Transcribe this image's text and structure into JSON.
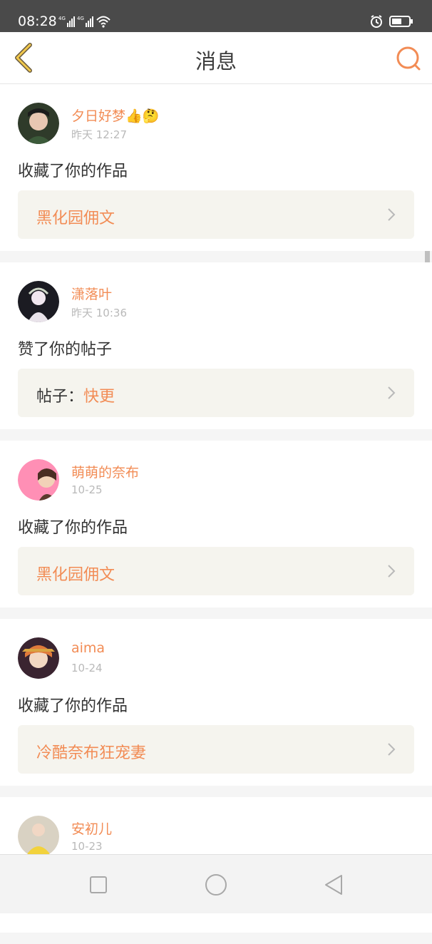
{
  "status_bar": {
    "time": "08:28",
    "network_1": "4G",
    "network_2": "4G"
  },
  "header": {
    "title": "消息"
  },
  "messages": [
    {
      "username": "夕日好梦👍🤔",
      "time": "昨天 12:27",
      "action": "收藏了你的作品",
      "ref_label": "",
      "ref_title": "黑化园佣文",
      "avatar_icon": "avatar-user-1"
    },
    {
      "username": "潇落叶",
      "time": "昨天 10:36",
      "action": "赞了你的帖子",
      "ref_label": "帖子：",
      "ref_title": "快更",
      "avatar_icon": "avatar-user-2"
    },
    {
      "username": "萌萌的奈布",
      "time": "10-25",
      "action": "收藏了你的作品",
      "ref_label": "",
      "ref_title": "黑化园佣文",
      "avatar_icon": "avatar-user-3"
    },
    {
      "username": "aima",
      "time": "10-24",
      "action": "收藏了你的作品",
      "ref_label": "",
      "ref_title": "冷酷奈布狂宠妻",
      "avatar_icon": "avatar-user-4"
    },
    {
      "username": "安初儿",
      "time": "10-23",
      "avatar_icon": "avatar-user-5"
    }
  ],
  "colors": {
    "accent": "#f28c55",
    "status_bar": "#4a4a4a",
    "ref_box": "#f5f4ee"
  }
}
